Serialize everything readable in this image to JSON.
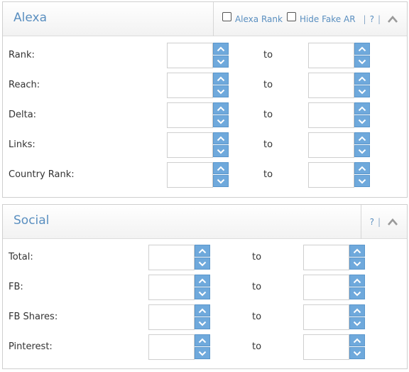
{
  "alexa": {
    "title": "Alexa",
    "alexa_rank_label": "Alexa Rank",
    "hide_fake_label": "Hide Fake AR",
    "separator": "|",
    "help_label": "?",
    "to_label": "to",
    "rows": [
      {
        "label": "Rank:"
      },
      {
        "label": "Reach:"
      },
      {
        "label": "Delta:"
      },
      {
        "label": "Links:"
      },
      {
        "label": "Country Rank:"
      }
    ]
  },
  "social": {
    "title": "Social",
    "help_label": "?",
    "separator": "|",
    "to_label": "to",
    "rows": [
      {
        "label": "Total:"
      },
      {
        "label": "FB:"
      },
      {
        "label": "FB Shares:"
      },
      {
        "label": "Pinterest:"
      }
    ]
  },
  "colors": {
    "accent": "#5a8fc0",
    "spinner_button": "#6fa9dc"
  }
}
